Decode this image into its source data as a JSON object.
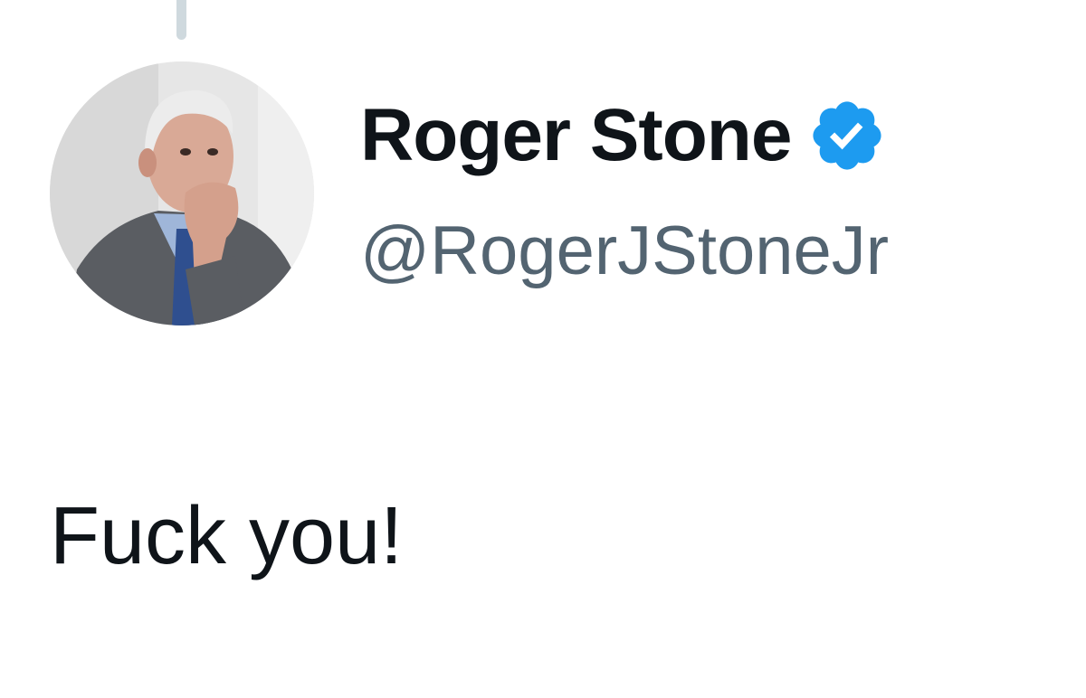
{
  "thread": {
    "connector_color": "#cfd9de"
  },
  "author": {
    "display_name": "Roger Stone",
    "handle": "@RogerJStoneJr",
    "verified": true,
    "verified_icon": "verified-badge-icon",
    "verified_color": "#1d9bf0",
    "avatar_icon": "profile-photo"
  },
  "tweet": {
    "text": "Fuck you!"
  },
  "colors": {
    "text_primary": "#0f1419",
    "text_secondary": "#536471",
    "background": "#ffffff"
  }
}
